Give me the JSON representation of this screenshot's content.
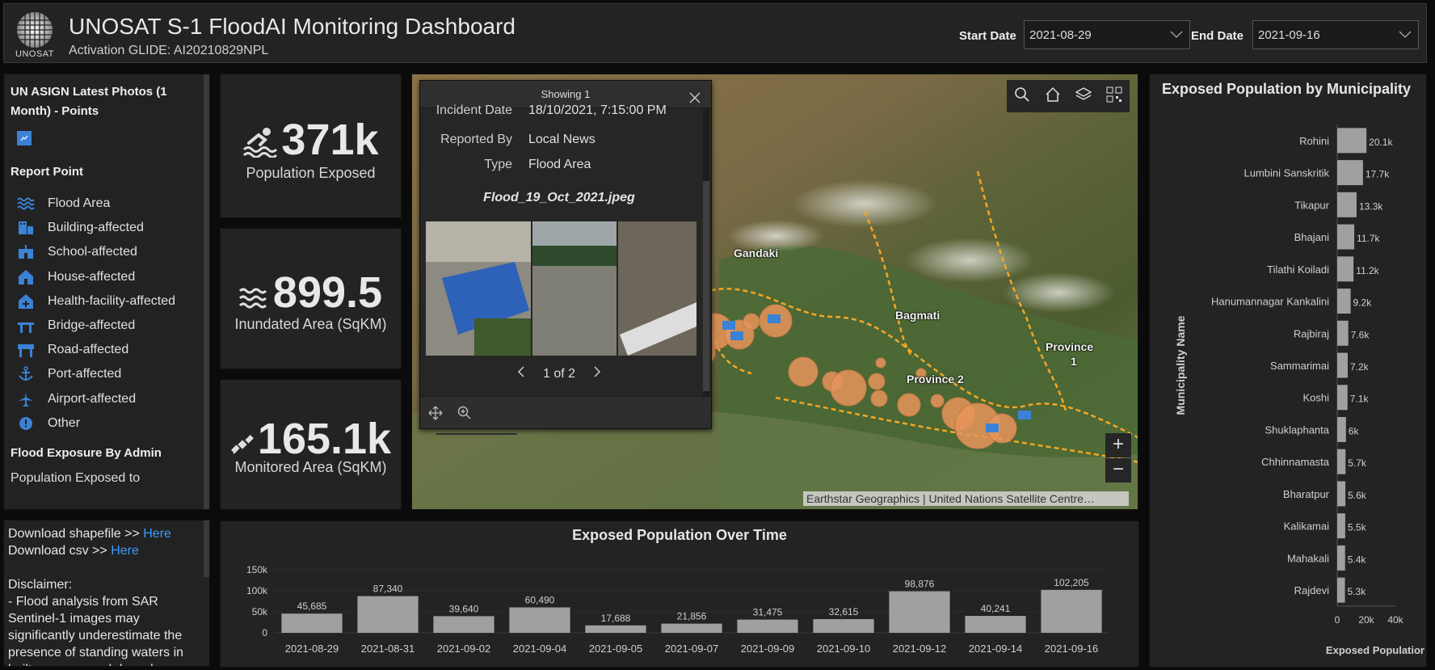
{
  "header": {
    "logo_text": "UNOSAT",
    "title": "UNOSAT S-1 FloodAI Monitoring Dashboard",
    "subtitle": "Activation GLIDE: AI20210829NPL",
    "start_label": "Start Date",
    "start_value": "2021-08-29",
    "end_label": "End Date",
    "end_value": "2021-09-16"
  },
  "legend": {
    "section1_title": "UN ASIGN Latest Photos (1 Month) - Points",
    "section2_title": "Report Point",
    "items": [
      {
        "label": "Flood Area",
        "icon": "flood-area-icon"
      },
      {
        "label": "Building-affected",
        "icon": "building-icon"
      },
      {
        "label": "School-affected",
        "icon": "school-icon"
      },
      {
        "label": "House-affected",
        "icon": "house-icon"
      },
      {
        "label": "Health-facility-affected",
        "icon": "health-facility-icon"
      },
      {
        "label": "Bridge-affected",
        "icon": "bridge-icon"
      },
      {
        "label": "Road-affected",
        "icon": "road-icon"
      },
      {
        "label": "Port-affected",
        "icon": "anchor-icon"
      },
      {
        "label": "Airport-affected",
        "icon": "airplane-icon"
      },
      {
        "label": "Other",
        "icon": "info-icon"
      }
    ],
    "section3_title": "Flood Exposure By Admin",
    "section3_text": "Population Exposed to"
  },
  "info": {
    "download_shp": "Download  shapefile >> ",
    "download_csv": "Download  csv >> ",
    "link_here": "Here",
    "disclaimer_title": "Disclaimer:",
    "disclaimer_text": "- Flood analysis from SAR Sentinel-1 images may significantly underestimate the presence of standing waters in built-up areas and densely"
  },
  "stats": [
    {
      "value": "371k",
      "label": "Population Exposed",
      "icon": "swimmer-icon"
    },
    {
      "value": "899.5",
      "label": "Inundated Area (SqKM)",
      "icon": "water-waves-icon"
    },
    {
      "value": "165.1k",
      "label": "Monitored Area (SqKM)",
      "icon": "satellite-icon"
    }
  ],
  "popup": {
    "header": "Showing 1",
    "fields": [
      {
        "key": "Incident Date",
        "value": "18/10/2021, 7:15:00 PM"
      },
      {
        "key": "Reported By",
        "value": "Local News"
      },
      {
        "key": "Type",
        "value": "Flood Area"
      }
    ],
    "image_title": "Flood_19_Oct_2021.jpeg",
    "pager": "1 of 2"
  },
  "map": {
    "labels": [
      "Gandaki",
      "Bagmati",
      "Province 2",
      "Province",
      "1"
    ],
    "attribution": "Earthstar Geographics | United Nations Satellite Centre…",
    "zoom_in": "+",
    "zoom_out": "−",
    "colors": {
      "circle": "#e8955a",
      "boundary": "#f5a623",
      "marker": "#3b82d6"
    }
  },
  "chart_data": [
    {
      "type": "bar",
      "title": "Exposed Population Over Time",
      "categories": [
        "2021-08-29",
        "2021-08-31",
        "2021-09-02",
        "2021-09-04",
        "2021-09-05",
        "2021-09-07",
        "2021-09-09",
        "2021-09-10",
        "2021-09-12",
        "2021-09-14",
        "2021-09-16"
      ],
      "values": [
        45685,
        87340,
        39640,
        60490,
        17688,
        21856,
        31475,
        32615,
        98876,
        40241,
        102205
      ],
      "data_labels": [
        "45,685",
        "87,340",
        "39,640",
        "60,490",
        "17,688",
        "21,856",
        "31,475",
        "32,615",
        "98,876",
        "40,241",
        "102,205"
      ],
      "yticks": [
        "0",
        "50k",
        "100k",
        "150k"
      ],
      "ylim": [
        0,
        150000
      ],
      "color": "#a0a0a0"
    },
    {
      "type": "bar",
      "orientation": "horizontal",
      "title": "Exposed Population by Municipality",
      "ylabel": "Municipality Name",
      "xlabel": "Exposed Populatior",
      "categories": [
        "Rohini",
        "Lumbini Sanskritik",
        "Tikapur",
        "Bhajani",
        "Tilathi Koiladi",
        "Hanumannagar Kankalini",
        "Rajbiraj",
        "Sammarimai",
        "Koshi",
        "Shuklaphanta",
        "Chhinnamasta",
        "Bharatpur",
        "Kalikamai",
        "Mahakali",
        "Rajdevi"
      ],
      "values": [
        20100,
        17700,
        13300,
        11700,
        11200,
        9200,
        7600,
        7200,
        7100,
        6000,
        5700,
        5600,
        5500,
        5400,
        5300
      ],
      "data_labels": [
        "20.1k",
        "17.7k",
        "13.3k",
        "11.7k",
        "11.2k",
        "9.2k",
        "7.6k",
        "7.2k",
        "7.1k",
        "6k",
        "5.7k",
        "5.6k",
        "5.5k",
        "5.4k",
        "5.3k"
      ],
      "xticks": [
        "0",
        "20k",
        "40k"
      ],
      "xlim": [
        0,
        40000
      ],
      "color": "#a0a0a0"
    }
  ]
}
